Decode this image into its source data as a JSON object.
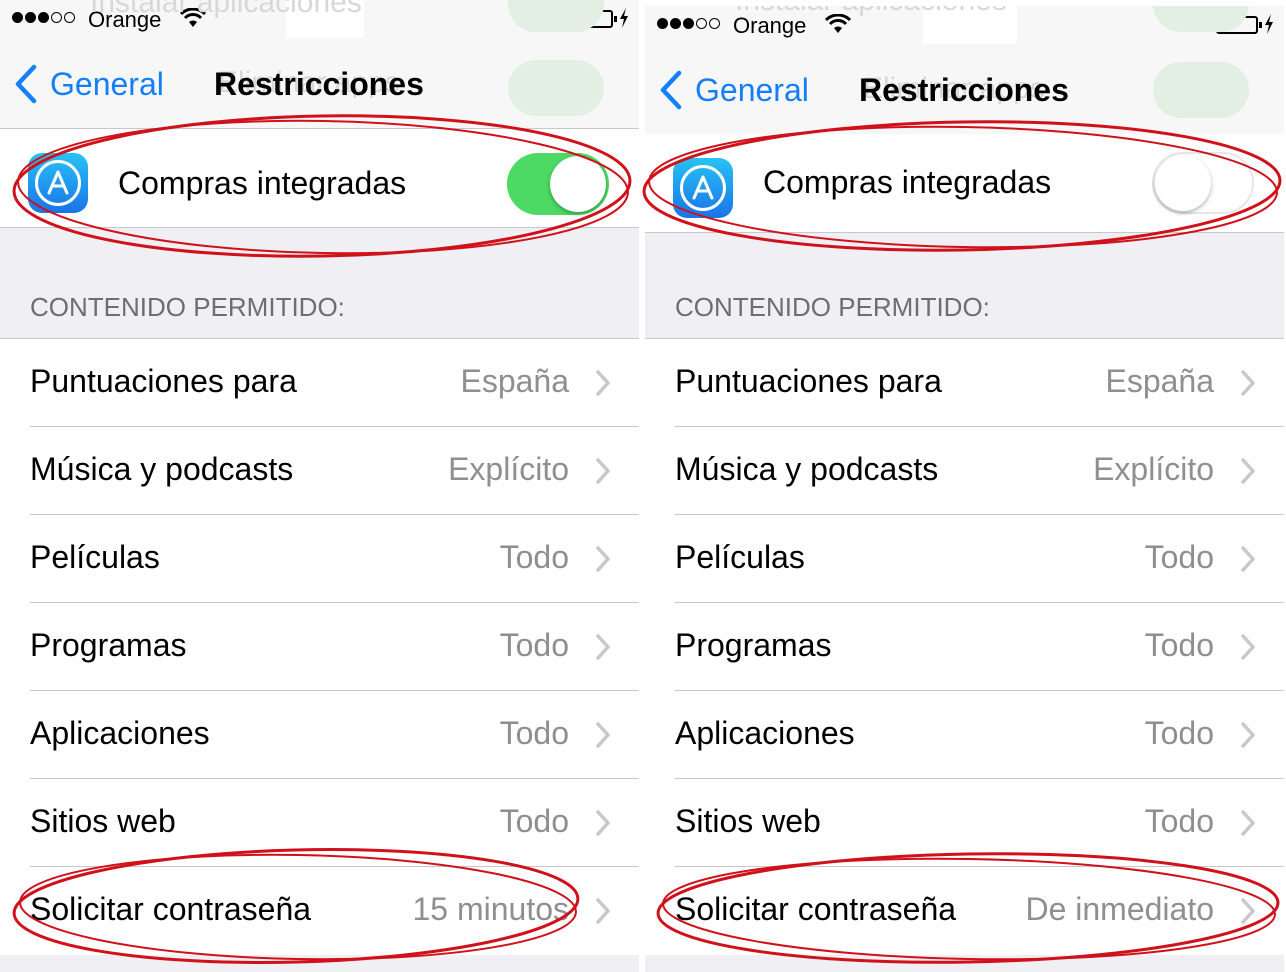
{
  "accent_color": "#147efb",
  "annotation_color": "#d0111a",
  "panels": [
    {
      "status": {
        "carrier": "Orange",
        "signal_bars": 3,
        "signal_total": 5,
        "battery_level": 0.12,
        "charging": true
      },
      "ghost": {
        "top_label": "Instalar aplicaciones",
        "second_label": "Eliminar apps"
      },
      "nav": {
        "back_label": "General",
        "title": "Restricciones"
      },
      "purchase": {
        "label": "Compras integradas",
        "toggle_on": true,
        "icon": "app-store-icon"
      },
      "section_header": "CONTENIDO PERMITIDO:",
      "rows": [
        {
          "label": "Puntuaciones para",
          "value": "España"
        },
        {
          "label": "Música y podcasts",
          "value": "Explícito"
        },
        {
          "label": "Películas",
          "value": "Todo"
        },
        {
          "label": "Programas",
          "value": "Todo"
        },
        {
          "label": "Aplicaciones",
          "value": "Todo"
        },
        {
          "label": "Sitios web",
          "value": "Todo"
        },
        {
          "label": "Solicitar contraseña",
          "value": "15 minutos"
        }
      ]
    },
    {
      "status": {
        "carrier": "Orange",
        "signal_bars": 3,
        "signal_total": 5,
        "battery_level": 0.12,
        "charging": true
      },
      "ghost": {
        "top_label": "Instalar aplicaciones",
        "second_label": "Eliminar apps"
      },
      "nav": {
        "back_label": "General",
        "title": "Restricciones"
      },
      "purchase": {
        "label": "Compras integradas",
        "toggle_on": false,
        "icon": "app-store-icon"
      },
      "section_header": "CONTENIDO PERMITIDO:",
      "rows": [
        {
          "label": "Puntuaciones para",
          "value": "España"
        },
        {
          "label": "Música y podcasts",
          "value": "Explícito"
        },
        {
          "label": "Películas",
          "value": "Todo"
        },
        {
          "label": "Programas",
          "value": "Todo"
        },
        {
          "label": "Aplicaciones",
          "value": "Todo"
        },
        {
          "label": "Sitios web",
          "value": "Todo"
        },
        {
          "label": "Solicitar contraseña",
          "value": "De inmediato"
        }
      ]
    }
  ]
}
